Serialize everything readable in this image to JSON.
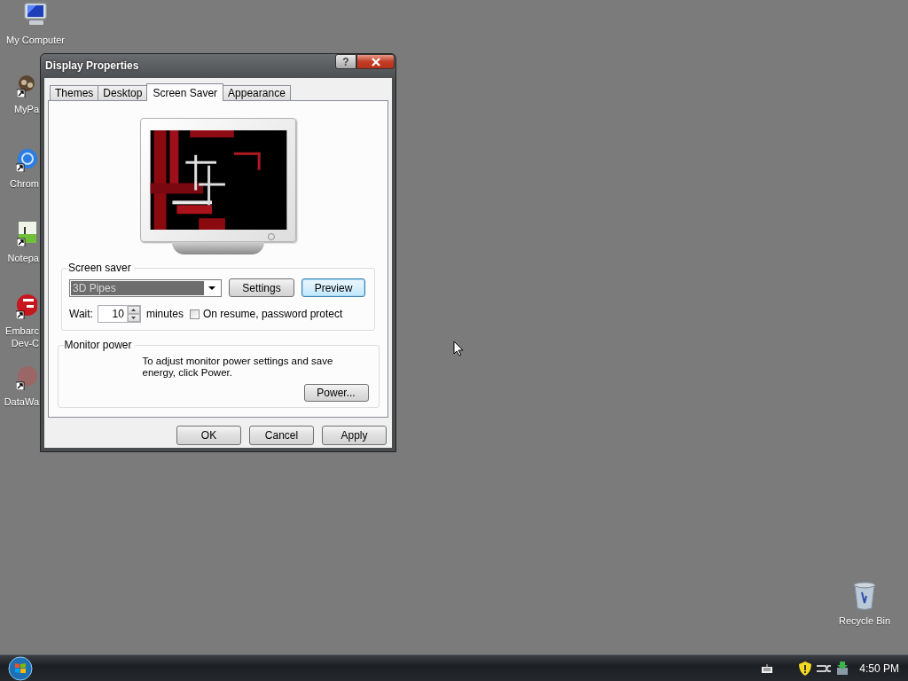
{
  "desktop_icons": [
    {
      "label": "My Computer",
      "kind": "full"
    },
    {
      "label": "MyPa",
      "kind": "partial"
    },
    {
      "label": "Chrom",
      "kind": "partial"
    },
    {
      "label": "Notepa",
      "kind": "partial"
    },
    {
      "label": "Embarc\nDev-C",
      "kind": "partial"
    },
    {
      "label": "DataWa",
      "kind": "partial"
    }
  ],
  "recycle_bin": {
    "label": "Recycle Bin"
  },
  "dialog": {
    "title": "Display Properties",
    "help_button": "?",
    "tabs": [
      {
        "label": "Themes",
        "selected": false
      },
      {
        "label": "Desktop",
        "selected": false
      },
      {
        "label": "Screen Saver",
        "selected": true
      },
      {
        "label": "Appearance",
        "selected": false
      }
    ],
    "screen_saver": {
      "legend": "Screen saver",
      "selected_value": "3D Pipes",
      "buttons": [
        {
          "label": "Settings",
          "default": false
        },
        {
          "label": "Preview",
          "default": true
        }
      ],
      "wait_label": "Wait:",
      "wait_value": "10",
      "wait_unit": "minutes",
      "password_protect": {
        "label": "On resume, password protect",
        "checked": false
      }
    },
    "monitor_power": {
      "legend": "Monitor power",
      "text": "To adjust monitor power settings and save energy, click Power.",
      "button": "Power..."
    },
    "buttons": [
      "OK",
      "Cancel",
      "Apply"
    ]
  },
  "taskbar": {
    "clock": "4:50 PM"
  }
}
